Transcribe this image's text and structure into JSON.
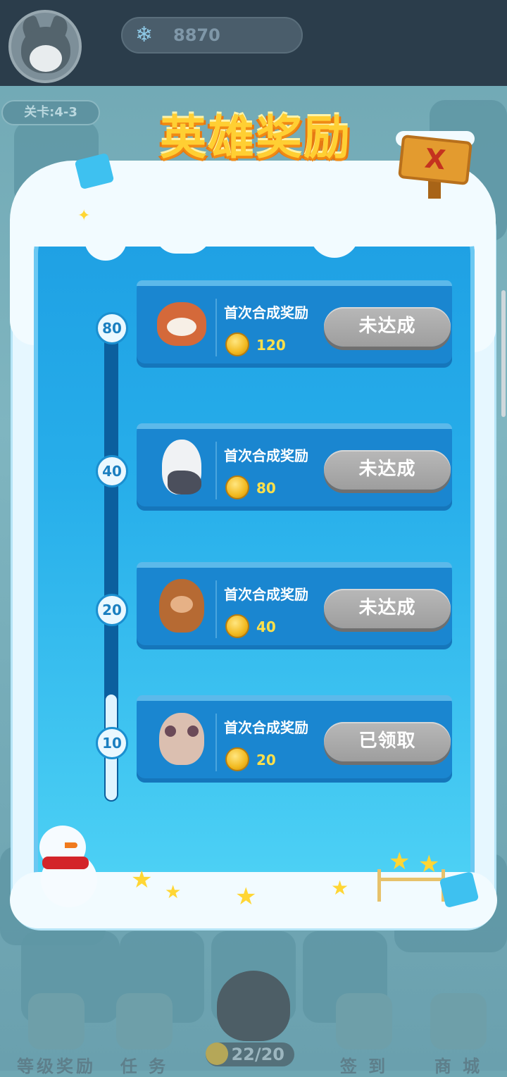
{
  "top_bar": {
    "avatar_icon": "husky-avatar-icon",
    "currency_icon": "snowflake-icon",
    "currency_value": "8870"
  },
  "background": {
    "level_label": "关卡:4-3",
    "bottom_nav": [
      {
        "label": "等级奖励",
        "icon": "gift-icon"
      },
      {
        "label": "任 务",
        "icon": "task-scroll-icon"
      },
      {
        "label": "签 到",
        "icon": "calendar-icon"
      },
      {
        "label": "商 城",
        "icon": "shop-igloo-icon"
      }
    ],
    "center_counter": "22/20"
  },
  "modal": {
    "title": "英雄奖励",
    "close_icon": "close-icon",
    "close_label": "X",
    "milestones": [
      {
        "level": "80",
        "caption": "首次合成奖励",
        "reward": "120",
        "button": "未达成",
        "pet_icon": "red-panda-icon",
        "claimed": false
      },
      {
        "level": "40",
        "caption": "首次合成奖励",
        "reward": "80",
        "button": "未达成",
        "pet_icon": "eagle-icon",
        "claimed": false
      },
      {
        "level": "20",
        "caption": "首次合成奖励",
        "reward": "40",
        "button": "未达成",
        "pet_icon": "beaver-icon",
        "claimed": false
      },
      {
        "level": "10",
        "caption": "首次合成奖励",
        "reward": "20",
        "button": "已领取",
        "pet_icon": "lemur-icon",
        "claimed": true
      }
    ],
    "colors": {
      "panel": "#27aeea",
      "card": "#1a86d0",
      "button_disabled": "#a8a8a8",
      "reward_text": "#ffe04a",
      "title": "#ffcf33"
    }
  }
}
